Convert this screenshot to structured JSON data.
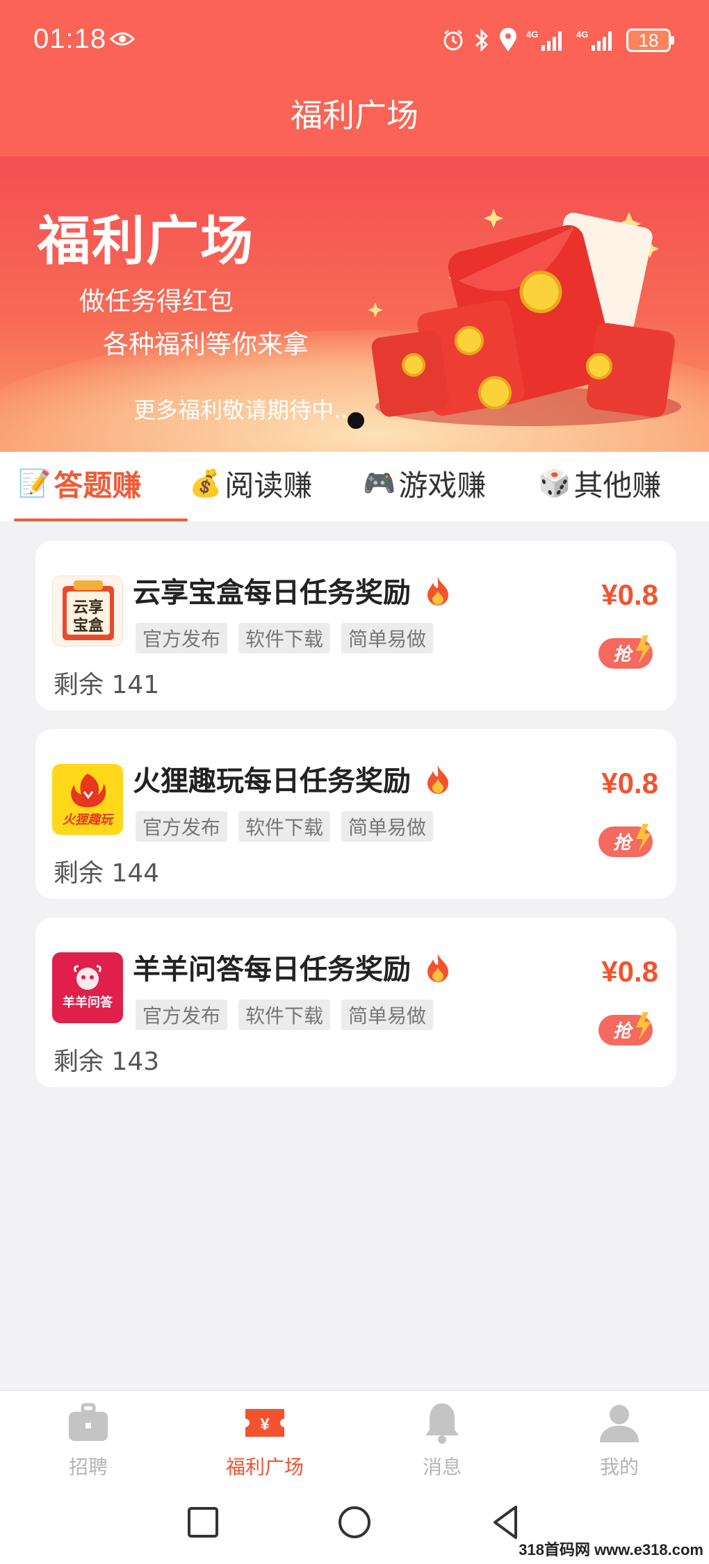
{
  "status_bar": {
    "time": "01:18",
    "battery": "18"
  },
  "header": {
    "title": "福利广场"
  },
  "banner": {
    "title": "福利广场",
    "line1": "做任务得红包",
    "line2": "各种福利等你来拿",
    "line3": "更多福利敬请期待中..."
  },
  "tabs": [
    {
      "emoji": "📝",
      "label": "答题赚",
      "active": true
    },
    {
      "emoji": "💰",
      "label": "阅读赚",
      "active": false
    },
    {
      "emoji": "🎮",
      "label": "游戏赚",
      "active": false
    },
    {
      "emoji": "🎲",
      "label": "其他赚",
      "active": false
    }
  ],
  "tasks": [
    {
      "title": "云享宝盒每日任务奖励",
      "logo_text": "云享宝盒",
      "tags": [
        "官方发布",
        "软件下载",
        "简单易做"
      ],
      "remaining": "剩余 141",
      "price": "¥0.8",
      "grab_label": "抢"
    },
    {
      "title": "火狸趣玩每日任务奖励",
      "logo_text": "火狸趣玩",
      "tags": [
        "官方发布",
        "软件下载",
        "简单易做"
      ],
      "remaining": "剩余 144",
      "price": "¥0.8",
      "grab_label": "抢"
    },
    {
      "title": "羊羊问答每日任务奖励",
      "logo_text": "羊羊问答",
      "tags": [
        "官方发布",
        "软件下载",
        "简单易做"
      ],
      "remaining": "剩余 143",
      "price": "¥0.8",
      "grab_label": "抢"
    }
  ],
  "bottom_nav": [
    {
      "label": "招聘",
      "icon": "briefcase-icon",
      "active": false
    },
    {
      "label": "福利广场",
      "icon": "ticket-icon",
      "active": true
    },
    {
      "label": "消息",
      "icon": "bell-icon",
      "active": false
    },
    {
      "label": "我的",
      "icon": "user-icon",
      "active": false
    }
  ],
  "nav_ticket_symbol": "¥",
  "watermark": "318首码网 www.e318.com",
  "colors": {
    "primary": "#fa6355",
    "accent": "#f2532e"
  }
}
